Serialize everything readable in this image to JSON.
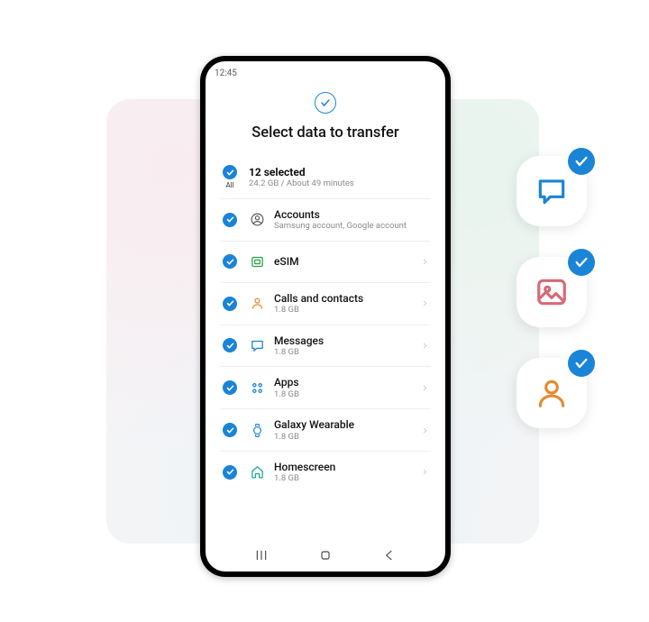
{
  "statusbar": {
    "time": "12:45"
  },
  "header": {
    "title": "Select data to transfer"
  },
  "summary": {
    "all_label": "All",
    "title": "12 selected",
    "sub": "24.2 GB / About 49 minutes"
  },
  "items": [
    {
      "icon": "account",
      "title": "Accounts",
      "sub": "Samsung account, Google account",
      "chevron": false
    },
    {
      "icon": "esim",
      "title": "eSIM",
      "sub": "",
      "chevron": true
    },
    {
      "icon": "contacts",
      "title": "Calls and contacts",
      "sub": "1.8 GB",
      "chevron": true
    },
    {
      "icon": "messages",
      "title": "Messages",
      "sub": "1.8 GB",
      "chevron": true
    },
    {
      "icon": "apps",
      "title": "Apps",
      "sub": "1.8 GB",
      "chevron": true
    },
    {
      "icon": "wearable",
      "title": "Galaxy Wearable",
      "sub": "1.8 GB",
      "chevron": true
    },
    {
      "icon": "home",
      "title": "Homescreen",
      "sub": "1.8 GB",
      "chevron": true
    }
  ],
  "colors": {
    "accent": "#1a84d6",
    "esim": "#2aa148",
    "contacts": "#e68a2e",
    "messages": "#1a84d6",
    "apps": "#1a84d6",
    "wearable": "#1a84d6",
    "home": "#18a99a",
    "gallery": "#d66a78",
    "person": "#e68a2e"
  }
}
